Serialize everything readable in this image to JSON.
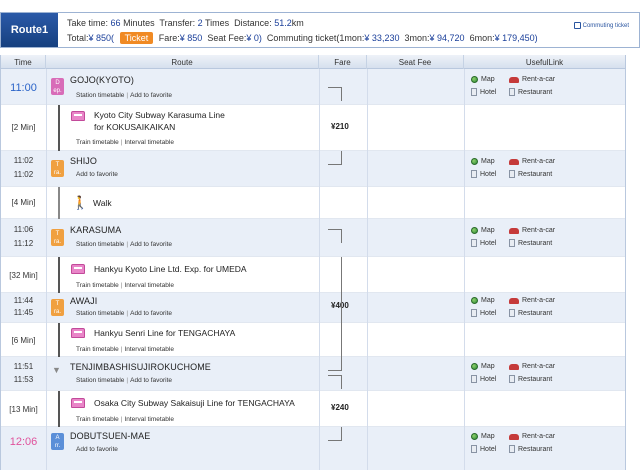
{
  "summary": {
    "route_label": "Route1",
    "take_time_label": "Take time:",
    "take_time_value": "66",
    "take_time_unit": "Minutes",
    "transfer_label": "Transfer:",
    "transfer_value": "2",
    "transfer_unit": "Times",
    "distance_label": "Distance:",
    "distance_value": "51.2",
    "distance_unit": "km",
    "total_label": "Total:",
    "total_value": "¥ 850(",
    "ticket_label": "Ticket",
    "fare_label": "Fare:",
    "fare_value": "¥ 850",
    "seatfee_label": "Seat Fee:",
    "seatfee_value": "¥ 0)",
    "commuting_label": "Commuting ticket(1mon:",
    "commuting_1mon": "¥ 33,230",
    "commuting_3mon_label": "3mon:",
    "commuting_3mon": "¥ 94,720",
    "commuting_6mon_label": "6mon:",
    "commuting_6mon": "¥ 179,450)",
    "commuting_link": "Commuting ticket"
  },
  "headers": {
    "time": "Time",
    "route": "Route",
    "fare": "Fare",
    "seat_fee": "Seat Fee",
    "useful_link": "UsefulLink"
  },
  "links": {
    "station_timetable": "Station timetable",
    "add_favorite": "Add to favorite",
    "train_timetable": "Train timetable",
    "interval_timetable": "Interval timetable",
    "map": "Map",
    "rentacar": "Rent-a-car",
    "hotel": "Hotel",
    "restaurant": "Restaurant",
    "sep": "|"
  },
  "stations": [
    {
      "name": "GOJO(KYOTO)",
      "time1": "11:00",
      "time2": "",
      "badge": "D\nep.",
      "kind": "dep"
    },
    {
      "name": "SHIJO",
      "time1": "11:02",
      "time2": "11:02",
      "badge": "T\nra.",
      "kind": "tr"
    },
    {
      "name": "KARASUMA",
      "time1": "11:06",
      "time2": "11:12",
      "badge": "T\nra.",
      "kind": "tr"
    },
    {
      "name": "AWAJI",
      "time1": "11:44",
      "time2": "11:45",
      "badge": "T\nra.",
      "kind": "tr"
    },
    {
      "name": "TENJIMBASHISUJIROKUCHOME",
      "time1": "11:51",
      "time2": "11:53",
      "badge": "",
      "kind": "pass"
    },
    {
      "name": "DOBUTSUEN-MAE",
      "time1": "12:06",
      "time2": "",
      "badge": "A\nrr.",
      "kind": "arr"
    }
  ],
  "segments": [
    {
      "duration": "[2 Min]",
      "line1": "Kyoto City Subway Karasuma Line",
      "line2": "for KOKUSAIKAIKAN"
    },
    {
      "duration": "[4 Min]",
      "line1": "Walk",
      "line2": ""
    },
    {
      "duration": "[32 Min]",
      "line1": "Hankyu Kyoto Line Ltd. Exp. for UMEDA",
      "line2": ""
    },
    {
      "duration": "[6 Min]",
      "line1": "Hankyu Senri Line  for TENGACHAYA",
      "line2": ""
    },
    {
      "duration": "[13 Min]",
      "line1": "Osaka City Subway Sakaisuji Line  for TENGACHAYA",
      "line2": ""
    }
  ],
  "fares": {
    "fare1": "¥210",
    "fare2": "¥400",
    "fare3": "¥240"
  }
}
